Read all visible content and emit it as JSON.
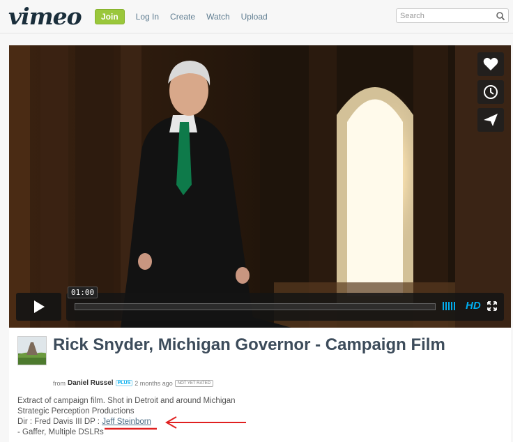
{
  "header": {
    "logo": "vimeo",
    "join_label": "Join",
    "nav": [
      "Log In",
      "Create",
      "Watch",
      "Upload"
    ],
    "search_placeholder": "Search"
  },
  "player": {
    "time": "01:00",
    "hd_label": "HD",
    "side_buttons": [
      "heart-icon",
      "clock-icon",
      "send-icon"
    ]
  },
  "video": {
    "title": "Rick Snyder, Michigan Governor - Campaign Film",
    "from_label": "from",
    "author": "Daniel Russel",
    "plus_badge": "PLUS",
    "age": "2 months ago",
    "rating_badge": "NOT YET RATED",
    "description": {
      "line1": "Extract of campaign film. Shot in Detroit and around Michigan",
      "line2": "Strategic Perception Productions",
      "line3_prefix": "Dir : Fred Davis III DP : ",
      "line3_link": "Jeff Steinborn",
      "line4": "- Gaffer, Multiple DSLRs"
    }
  },
  "colors": {
    "accent": "#00adef",
    "join": "#9ac73b",
    "annotation": "#e02020"
  }
}
